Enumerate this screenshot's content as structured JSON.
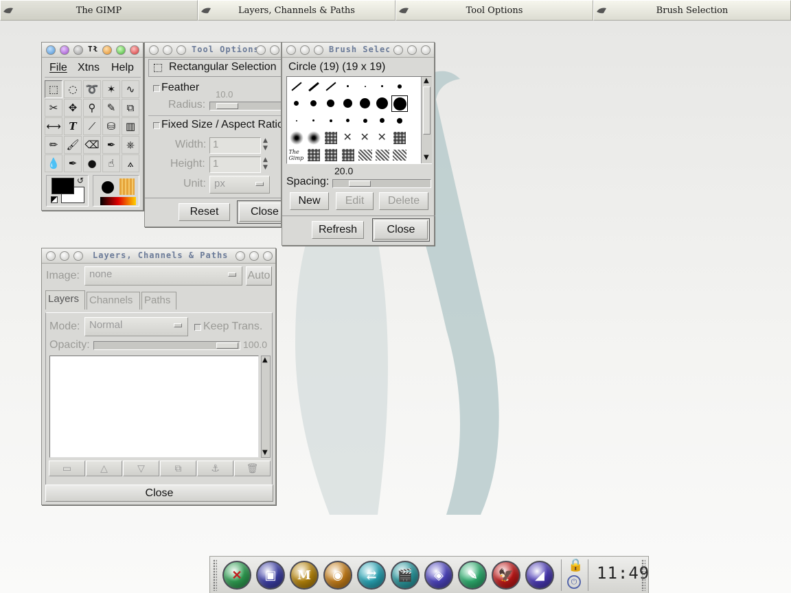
{
  "taskbar": {
    "items": [
      {
        "label": "The GIMP",
        "icon": "gimp-icon"
      },
      {
        "label": "Layers, Channels & Paths",
        "icon": "gimp-icon"
      },
      {
        "label": "Tool Options",
        "icon": "gimp-icon"
      },
      {
        "label": "Brush Selection",
        "icon": "gimp-icon"
      }
    ]
  },
  "toolbox": {
    "title": "The GIMP",
    "menu": [
      "File",
      "Xtns",
      "Help"
    ],
    "tools": [
      "rect-select-icon",
      "ellipse-select-icon",
      "lasso-icon",
      "magic-wand-icon",
      "bezier-select-icon",
      "intelligent-scissors-icon",
      "move-icon",
      "magnify-icon",
      "crop-icon",
      "transform-icon",
      "flip-icon",
      "text-icon",
      "color-picker-icon",
      "bucket-fill-icon",
      "blend-icon",
      "pencil-icon",
      "paintbrush-icon",
      "eraser-icon",
      "airbrush-icon",
      "clone-icon",
      "convolve-icon",
      "ink-icon",
      "dodge-burn-icon",
      "smudge-icon",
      "measure-icon"
    ],
    "fg_color": "#000000",
    "bg_color": "#ffffff"
  },
  "tool_options": {
    "title": "Tool Options",
    "heading": "Rectangular Selection",
    "feather": "Feather",
    "radius_label": "Radius:",
    "radius_value": "10.0",
    "radius_level": 0.1,
    "fixed": "Fixed Size / Aspect Ratio",
    "width_label": "Width:",
    "width_value": "1",
    "height_label": "Height:",
    "height_value": "1",
    "unit_label": "Unit:",
    "unit_value": "px",
    "reset": "Reset",
    "close": "Close"
  },
  "brush_selection": {
    "title": "Brush Selection",
    "brush_name": "Circle (19)  (19 x 19)",
    "spacing_value": "20.0",
    "spacing_level": 0.2,
    "spacing_label": "Spacing:",
    "new": "New",
    "edit": "Edit",
    "delete": "Delete",
    "refresh": "Refresh",
    "close": "Close"
  },
  "layers": {
    "title": "Layers, Channels & Paths",
    "image_label": "Image:",
    "image_value": "none",
    "auto": "Auto",
    "tabs": [
      "Layers",
      "Channels",
      "Paths"
    ],
    "mode_label": "Mode:",
    "mode_value": "Normal",
    "keep_trans": "Keep Trans.",
    "opacity_label": "Opacity:",
    "opacity_value": "100.0",
    "opacity_level": 1.0,
    "close": "Close"
  },
  "dock": {
    "apps": [
      {
        "icon": "x-logo-icon",
        "color": "#2fa052"
      },
      {
        "icon": "terminal-icon",
        "color": "#3d3fa8"
      },
      {
        "icon": "mail-icon",
        "color": "#b8860b"
      },
      {
        "icon": "cd-icon",
        "color": "#c77f1a"
      },
      {
        "icon": "network-icon",
        "color": "#2aa7b8"
      },
      {
        "icon": "film-icon",
        "color": "#2a9aa0"
      },
      {
        "icon": "web-icon",
        "color": "#4d44c0"
      },
      {
        "icon": "editor-icon",
        "color": "#2fb070"
      },
      {
        "icon": "bird-icon",
        "color": "#c01818"
      },
      {
        "icon": "gimp-icon",
        "color": "#4b3ab8"
      }
    ],
    "clock": "11:49"
  }
}
